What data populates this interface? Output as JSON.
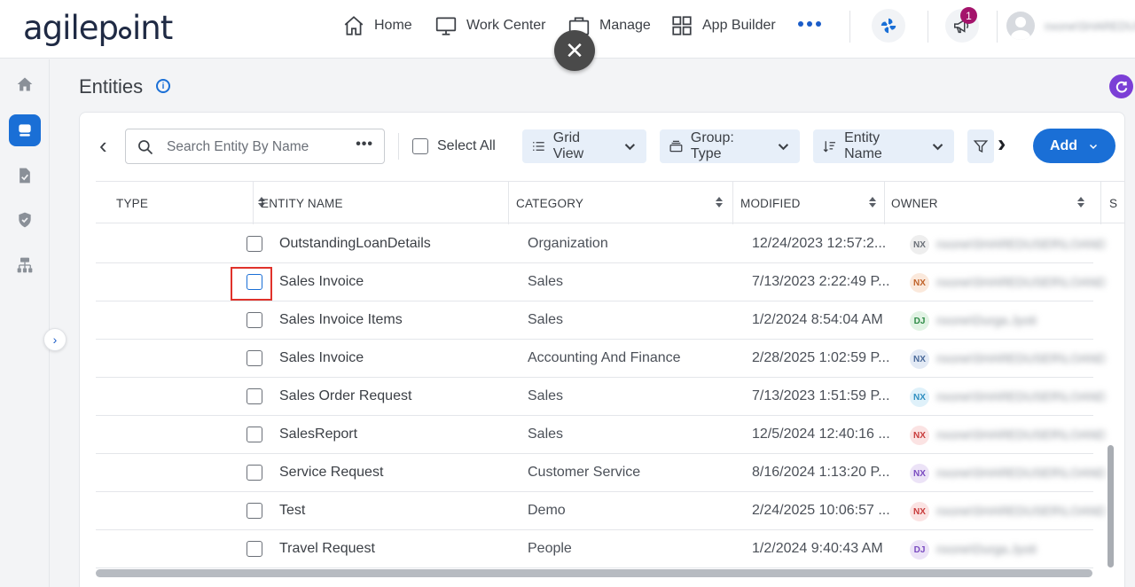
{
  "header": {
    "logo_text_a": "agilep",
    "logo_text_b": "int",
    "nav": [
      {
        "label": "Home",
        "icon": "home-icon"
      },
      {
        "label": "Work Center",
        "icon": "monitor-icon"
      },
      {
        "label": "Manage",
        "icon": "briefcase-icon"
      },
      {
        "label": "App Builder",
        "icon": "grid-icon"
      }
    ],
    "more_icon": "more-horizontal-icon",
    "notification_count": "1",
    "user_name": "nxone\\SHAREDUSER"
  },
  "overlay": {
    "close_symbol": "✕"
  },
  "page": {
    "title": "Entities",
    "info_symbol": "i"
  },
  "toolbar": {
    "back_symbol": "‹",
    "search_placeholder": "Search Entity By Name",
    "search_more": "•••",
    "select_all_label": "Select All",
    "grid_view_label": "Grid View",
    "group_label": "Group: Type",
    "sort_label": "Entity Name",
    "next_symbol": "›",
    "add_label": "Add"
  },
  "table": {
    "columns": [
      "TYPE",
      "ENTITY NAME",
      "CATEGORY",
      "MODIFIED",
      "OWNER",
      "S"
    ],
    "rows": [
      {
        "name": "OutstandingLoanDetails",
        "category": "Organization",
        "modified": "12/24/2023 12:57:2...",
        "owner_initials": "NX",
        "owner_name": "nxone\\SHAREDUSER\\LOANDIVISION"
      },
      {
        "name": "Sales Invoice",
        "category": "Sales",
        "modified": "7/13/2023 2:22:49 P...",
        "owner_initials": "NX",
        "owner_name": "nxone\\SHAREDUSER\\LOANDIVISION"
      },
      {
        "name": "Sales Invoice Items",
        "category": "Sales",
        "modified": "1/2/2024 8:54:04 AM",
        "owner_initials": "DJ",
        "owner_name": "nxone\\Durga.Jyoti"
      },
      {
        "name": "Sales Invoice",
        "category": "Accounting And Finance",
        "modified": "2/28/2025 1:02:59 P...",
        "owner_initials": "NX",
        "owner_name": "nxone\\SHAREDUSER\\LOANDIVISION"
      },
      {
        "name": "Sales Order Request",
        "category": "Sales",
        "modified": "7/13/2023 1:51:59 P...",
        "owner_initials": "NX",
        "owner_name": "nxone\\SHAREDUSER\\LOANDIVISION"
      },
      {
        "name": "SalesReport",
        "category": "Sales",
        "modified": "12/5/2024 12:40:16 ...",
        "owner_initials": "NX",
        "owner_name": "nxone\\SHAREDUSER\\LOANDIVISION"
      },
      {
        "name": "Service Request",
        "category": "Customer Service",
        "modified": "8/16/2024 1:13:20 P...",
        "owner_initials": "NX",
        "owner_name": "nxone\\SHAREDUSER\\LOANDIVISION"
      },
      {
        "name": "Test",
        "category": "Demo",
        "modified": "2/24/2025 10:06:57 ...",
        "owner_initials": "NX",
        "owner_name": "nxone\\SHAREDUSER\\LOANDIVISION"
      },
      {
        "name": "Travel Request",
        "category": "People",
        "modified": "1/2/2024 9:40:43 AM",
        "owner_initials": "DJ",
        "owner_name": "nxone\\Durga.Jyoti"
      }
    ]
  },
  "colors": {
    "accent": "#1a6fd6",
    "highlight": "#e0322b",
    "refresh": "#7b3fd6",
    "badge": "#a4136b"
  }
}
